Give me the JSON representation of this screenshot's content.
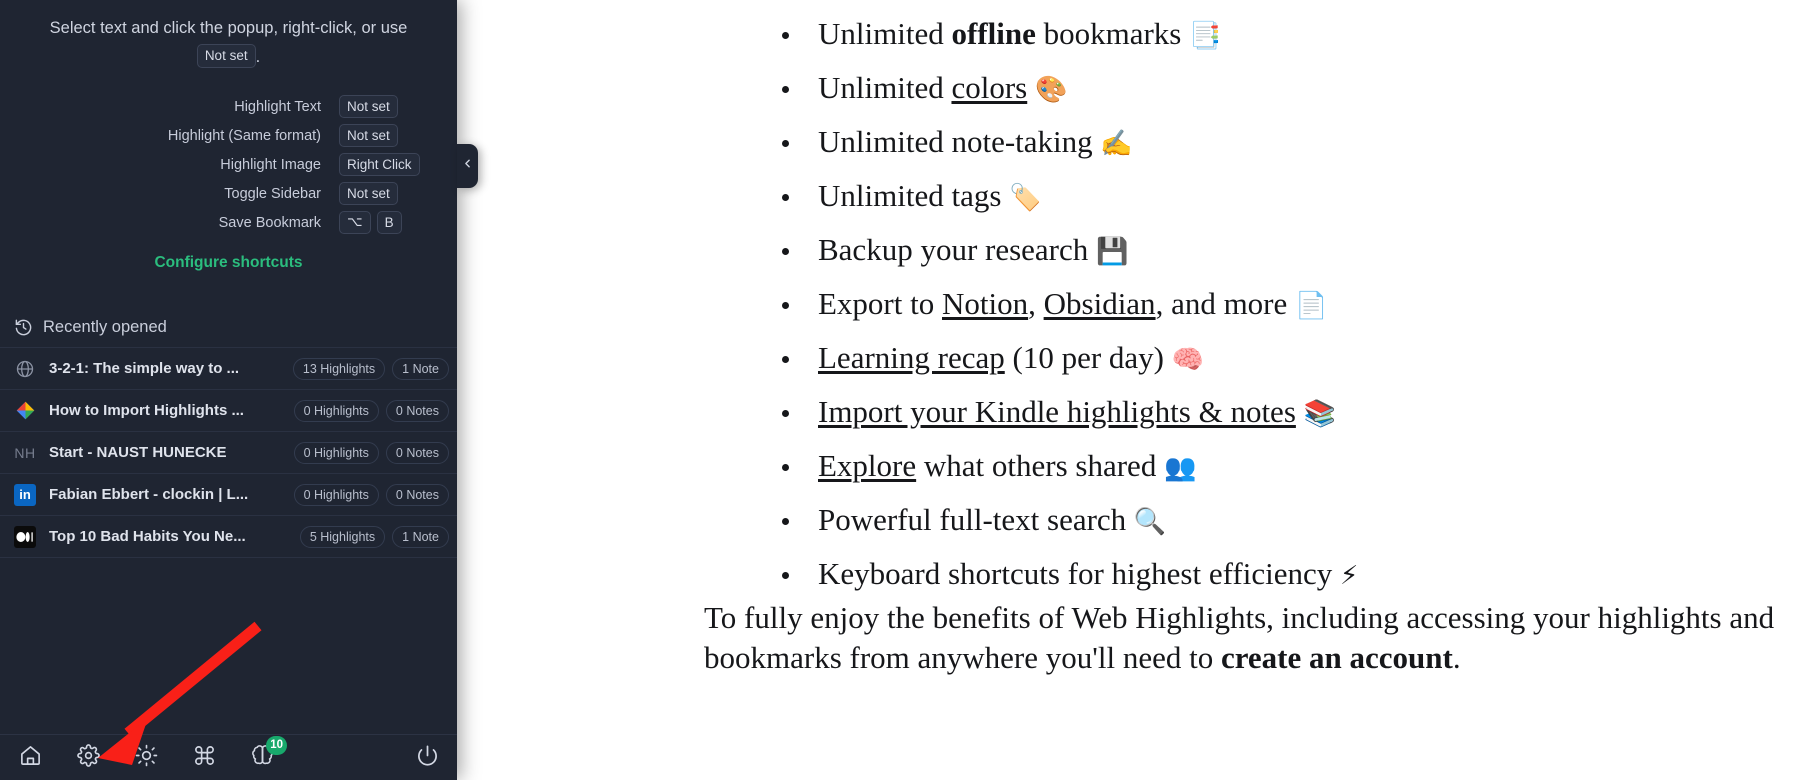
{
  "sidebar": {
    "hint": {
      "before": "Select text and click the popup, right-click, or use",
      "key": "Not set",
      "after": "."
    },
    "shortcuts": [
      {
        "label": "Highlight Text",
        "keys": [
          "Not set"
        ]
      },
      {
        "label": "Highlight (Same format)",
        "keys": [
          "Not set"
        ]
      },
      {
        "label": "Highlight Image",
        "keys": [
          "Right Click"
        ]
      },
      {
        "label": "Toggle Sidebar",
        "keys": [
          "Not set"
        ]
      },
      {
        "label": "Save Bookmark",
        "keys": [
          "⌥",
          "B"
        ]
      }
    ],
    "configure_link": "Configure shortcuts",
    "recent": {
      "heading": "Recently opened",
      "heading_icon": "history-icon",
      "items": [
        {
          "icon": "globe-icon",
          "title": "3-2-1: The simple way to ...",
          "highlights": "13 Highlights",
          "notes": "1 Note"
        },
        {
          "icon": "google-drive-icon",
          "title": "How to Import Highlights ...",
          "highlights": "0 Highlights",
          "notes": "0 Notes"
        },
        {
          "icon": "nh-initials-icon",
          "title": "Start - NAUST HUNECKE",
          "highlights": "0 Highlights",
          "notes": "0 Notes"
        },
        {
          "icon": "linkedin-icon",
          "title": "Fabian Ebbert - clockin | L...",
          "highlights": "0 Highlights",
          "notes": "0 Notes"
        },
        {
          "icon": "medium-icon",
          "title": "Top 10 Bad Habits You Ne...",
          "highlights": "5 Highlights",
          "notes": "1 Note"
        }
      ]
    },
    "toolbar": [
      {
        "icon": "home-icon",
        "badge": null
      },
      {
        "icon": "gear-icon",
        "badge": null
      },
      {
        "icon": "brightness-icon",
        "badge": null
      },
      {
        "icon": "command-icon",
        "badge": null
      },
      {
        "icon": "brain-icon",
        "badge": "10"
      },
      {
        "icon": "power-icon",
        "badge": null
      }
    ],
    "collapse_handle_icon": "chevron-left-icon"
  },
  "page": {
    "features": [
      {
        "parts": [
          {
            "t": "Unlimited ",
            "s": "plain"
          },
          {
            "t": "offline",
            "s": "bold"
          },
          {
            "t": " bookmarks ",
            "s": "plain"
          },
          {
            "t": "📑",
            "s": "emoji"
          }
        ]
      },
      {
        "parts": [
          {
            "t": "Unlimited ",
            "s": "plain"
          },
          {
            "t": "colors",
            "s": "underline"
          },
          {
            "t": " ",
            "s": "plain"
          },
          {
            "t": "🎨",
            "s": "emoji"
          }
        ]
      },
      {
        "parts": [
          {
            "t": "Unlimited note-taking ",
            "s": "plain"
          },
          {
            "t": "✍️",
            "s": "emoji"
          }
        ]
      },
      {
        "parts": [
          {
            "t": "Unlimited tags ",
            "s": "plain"
          },
          {
            "t": "🏷️",
            "s": "emoji"
          }
        ]
      },
      {
        "parts": [
          {
            "t": "Backup your research ",
            "s": "plain"
          },
          {
            "t": "💾",
            "s": "emoji"
          }
        ]
      },
      {
        "parts": [
          {
            "t": "Export to ",
            "s": "plain"
          },
          {
            "t": "Notion",
            "s": "underline"
          },
          {
            "t": ", ",
            "s": "plain"
          },
          {
            "t": "Obsidian",
            "s": "underline"
          },
          {
            "t": ", and more ",
            "s": "plain"
          },
          {
            "t": "📄",
            "s": "emoji"
          }
        ]
      },
      {
        "parts": [
          {
            "t": "Learning recap",
            "s": "underline"
          },
          {
            "t": " (10 per day) ",
            "s": "plain"
          },
          {
            "t": "🧠",
            "s": "emoji"
          }
        ]
      },
      {
        "parts": [
          {
            "t": "Import your Kindle highlights & notes",
            "s": "underline"
          },
          {
            "t": " ",
            "s": "plain"
          },
          {
            "t": "📚",
            "s": "emoji"
          }
        ]
      },
      {
        "parts": [
          {
            "t": "Explore",
            "s": "underline"
          },
          {
            "t": " what others shared ",
            "s": "plain"
          },
          {
            "t": "👥",
            "s": "emoji"
          }
        ]
      },
      {
        "parts": [
          {
            "t": "Powerful full-text search ",
            "s": "plain"
          },
          {
            "t": "🔍",
            "s": "emoji"
          }
        ]
      },
      {
        "parts": [
          {
            "t": "Keyboard shortcuts for highest efficiency ",
            "s": "plain"
          },
          {
            "t": "⚡",
            "s": "emoji"
          }
        ]
      }
    ],
    "closing": {
      "parts": [
        {
          "t": "To fully enjoy the benefits of Web Highlights, including accessing your highlights and bookmarks from anywhere you'll need to ",
          "s": "plain"
        },
        {
          "t": "create an account",
          "s": "bold"
        },
        {
          "t": ".",
          "s": "plain"
        }
      ]
    }
  },
  "annotation": {
    "type": "red-arrow",
    "color": "#f92018",
    "points_to": "gear-icon"
  },
  "colors": {
    "sidebar_bg": "#1f2532",
    "accent_green": "#2bbd7e",
    "badge_green": "#18a96c",
    "annotation_red": "#f92018"
  }
}
